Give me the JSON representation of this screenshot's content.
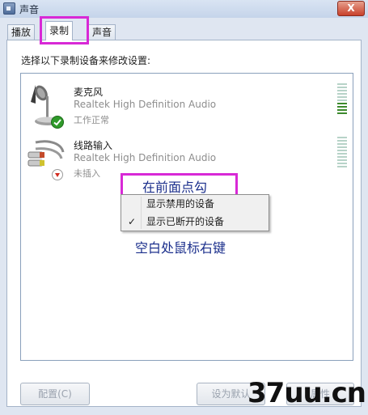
{
  "window": {
    "title": "声音",
    "close_glyph": "X"
  },
  "tabs": [
    {
      "label": "播放"
    },
    {
      "label": "录制"
    },
    {
      "label": "声音"
    }
  ],
  "prompt": "选择以下录制设备来修改设置:",
  "devices": [
    {
      "name": "麦克风",
      "driver": "Realtek High Definition Audio",
      "status": "工作正常",
      "icon": "microphone-icon",
      "badge": "green-check-icon",
      "level_fraction": 0.35
    },
    {
      "name": "线路输入",
      "driver": "Realtek High Definition Audio",
      "status": "未插入",
      "icon": "line-in-plug-icon",
      "badge": "red-down-arrow-icon",
      "level_fraction": 0
    }
  ],
  "context_menu": {
    "items": [
      {
        "label": "显示禁用的设备",
        "checked": false
      },
      {
        "label": "显示已断开的设备",
        "checked": true,
        "check_glyph": "✓"
      }
    ]
  },
  "annotations": {
    "top": "在前面点勾",
    "bottom": "空白处鼠标右键"
  },
  "buttons": {
    "configure": "配置(C)",
    "set_default": "设为默认",
    "properties": "属性"
  },
  "watermark": "37uu.cn",
  "colors": {
    "highlight": "#d829d6",
    "annotation": "#1b2f8c",
    "level_on": "#3d8a2e"
  }
}
